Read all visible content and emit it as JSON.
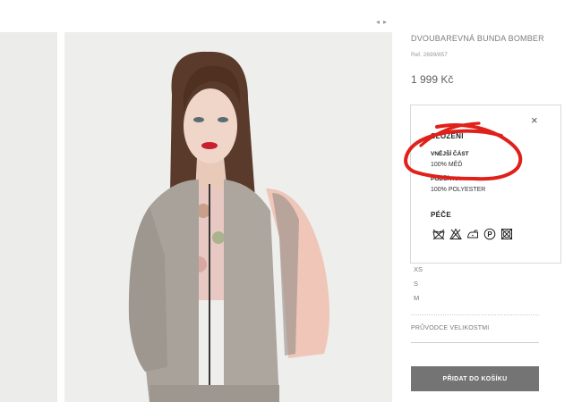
{
  "gallery": {
    "nav_prev": "◂",
    "nav_next": "▸"
  },
  "product": {
    "title": "DVOUBAREVNÁ BUNDA BOMBER",
    "ref": "Ref. 2699/857",
    "price": "1 999 Kč"
  },
  "composition": {
    "heading": "SLOŽENÍ",
    "outer_label": "VNĚJŠÍ ČÁST",
    "outer_value": "100% MĚĎ",
    "lining_label": "PODŠÍVKA",
    "lining_value": "100% POLYESTER",
    "care_heading": "PÉČE",
    "care_icons": [
      "do-not-wash-icon",
      "do-not-bleach-icon",
      "iron-low-icon",
      "dry-clean-p-icon",
      "do-not-tumble-dry-icon"
    ],
    "close_label": "×"
  },
  "sizes": [
    "XS",
    "S",
    "M"
  ],
  "size_guide": "PRŮVODCE VELIKOSTMI",
  "cart_button": "PŘIDAT DO KOŠÍKU",
  "colors": {
    "button": "#747474",
    "annotation": "#e0201a",
    "lips": "#c8202e"
  }
}
